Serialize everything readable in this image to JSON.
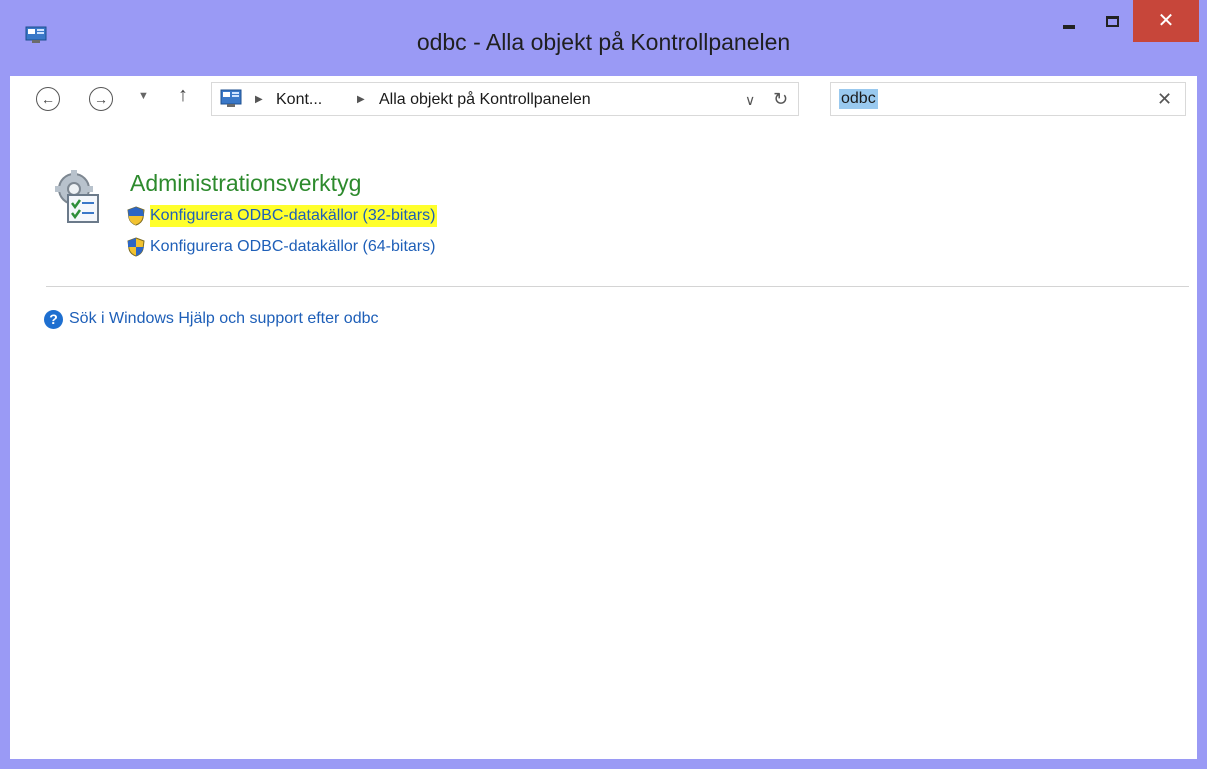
{
  "window": {
    "title": "odbc - Alla objekt på Kontrollpanelen",
    "close_label": "✕",
    "frame_color": "#9a9af5",
    "close_color": "#c7463a"
  },
  "navigation": {
    "back_glyph": "←",
    "forward_glyph": "→",
    "recent_glyph": "▼",
    "up_glyph": "↑",
    "breadcrumb": [
      "Kont...",
      "Alla objekt på Kontrollpanelen"
    ],
    "breadcrumb_separator": "▶",
    "address_dropdown_glyph": "∨",
    "refresh_glyph": "↻"
  },
  "search": {
    "value": "odbc",
    "clear_glyph": "✕"
  },
  "results": {
    "group_title": "Administrationsverktyg",
    "group_icon": "admin-tools-icon",
    "tasks": [
      {
        "label": "Konfigurera ODBC-datakällor (32-bitars)",
        "icon": "uac-shield-icon",
        "highlighted": true
      },
      {
        "label": "Konfigurera ODBC-datakällor (64-bitars)",
        "icon": "uac-shield-icon",
        "highlighted": false
      }
    ],
    "highlight_color": "#ffff2c",
    "link_color": "#1e5fb8",
    "title_color": "#2d8a2d"
  },
  "help": {
    "icon_glyph": "?",
    "label": "Sök i Windows Hjälp och support efter odbc"
  }
}
